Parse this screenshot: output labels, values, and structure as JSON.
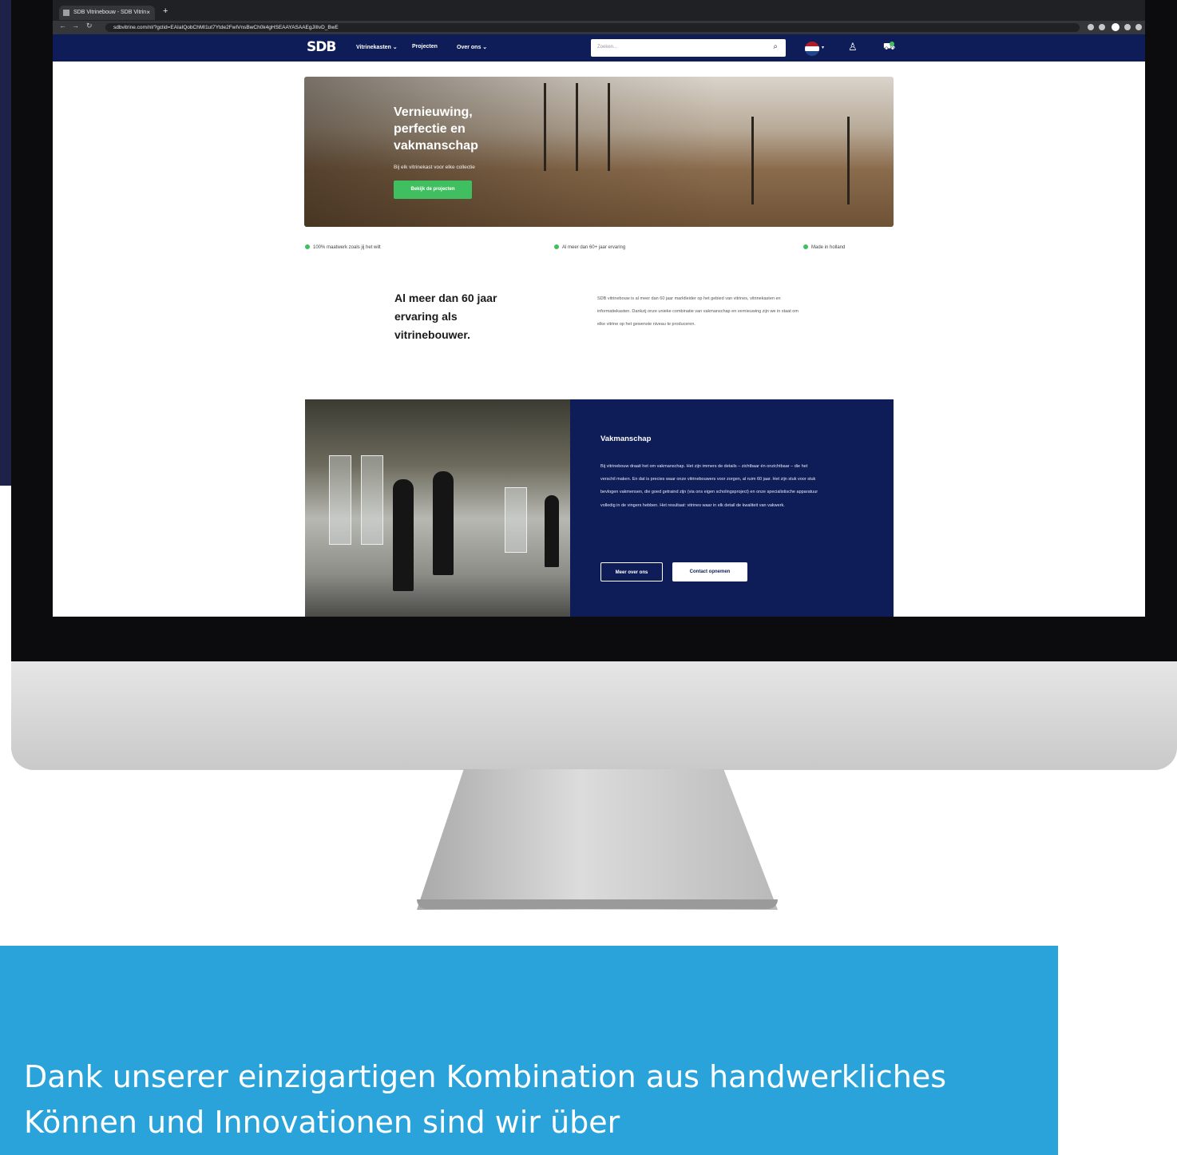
{
  "browser": {
    "tab_title": "SDB Vitrinebouw - SDB Vitrin",
    "tab_close": "×",
    "new_tab": "+",
    "url": "sdbvitrine.com/nl/?gclid=EAIaIQobChMI1ut7Ytde2FwIVnsBwCh0k4gHSEAAYASAAEgJIlIvD_BwE"
  },
  "header": {
    "logo": "SDB",
    "nav": [
      "Vitrinekasten ⌄",
      "Projecten",
      "Over ons ⌄"
    ],
    "search_placeholder": "Zoeken..."
  },
  "hero": {
    "title": "Vernieuwing, perfectie en vakmanschap",
    "subtitle": "Bij elk vitrinekast voor elke collectie",
    "cta": "Bekijk de projecten"
  },
  "usps": [
    "100% maatwerk zoals jij het wilt",
    "Al meer dan 60+ jaar ervaring",
    "Made in holland"
  ],
  "about": {
    "title": "Al meer dan 60 jaar ervaring als vitrinebouwer.",
    "text": "SDB vitrinebouw is al meer dan 60 jaar marktleider op het gebied van vitrines, vitrinekasten en informatiekasten. Dankzij onze unieke combinatie van vakmanschap en vernieuwing zijn we in staat om elke vitrine op het gewenste niveau te produceren."
  },
  "craft": {
    "title": "Vakmanschap",
    "text": "Bij vitrinebouw draait het om vakmanschap. Het zijn immers de details – zichtbaar én onzichtbaar – die het verschil maken. En dat is precies waar onze vitrinebouwers voor zorgen, al ruim 60 jaar. Het zijn stuk voor stuk bevlogen vakmensen, die goed getraind zijn (via ons eigen scholingsproject) en onze specialistische apparatuur volledig in de vingers hebben. Het resultaat: vitrines waar in elk detail de kwaliteit van vakwerk.",
    "btn_more": "Meer over ons",
    "btn_contact": "Contact opnemen"
  },
  "caption": {
    "text": "Dank unserer einzigartigen Kombination aus handwerkliches Können und Innovationen sind wir über"
  },
  "colors": {
    "navy": "#0e1d57",
    "green": "#3fbf5f",
    "caption_blue": "#2aa3da"
  }
}
